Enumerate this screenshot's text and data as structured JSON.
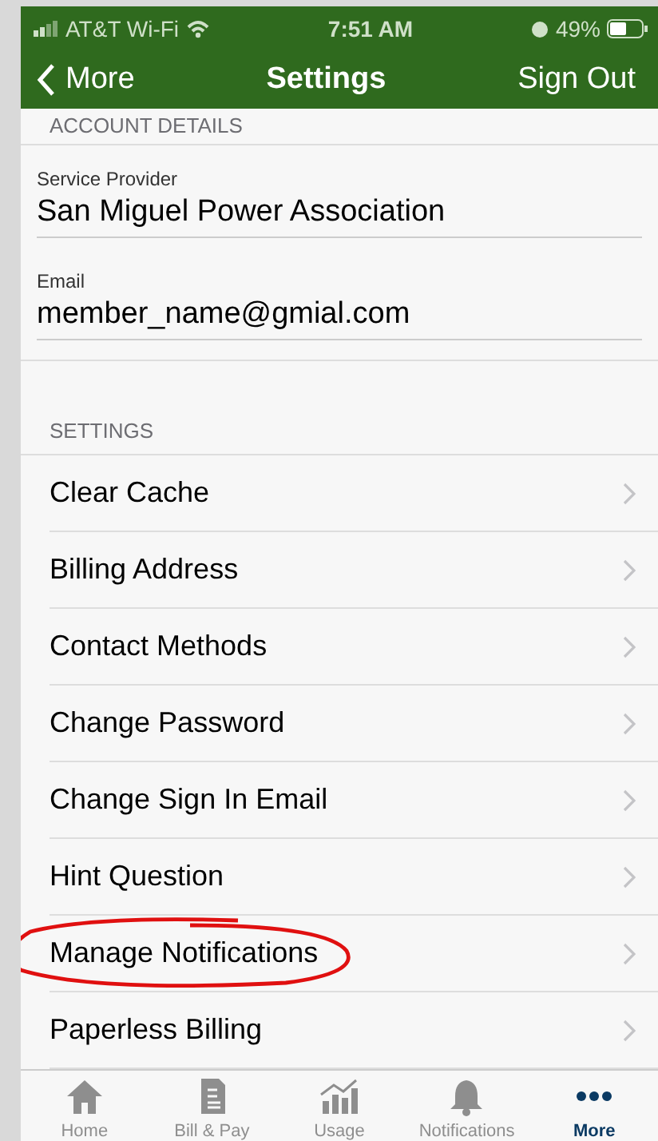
{
  "status_bar": {
    "carrier": "AT&T Wi-Fi",
    "time": "7:51 AM",
    "battery": "49%"
  },
  "nav": {
    "back": "More",
    "title": "Settings",
    "action": "Sign Out"
  },
  "account_details": {
    "header": "ACCOUNT DETAILS",
    "fields": [
      {
        "label": "Service Provider",
        "value": "San Miguel Power Association"
      },
      {
        "label": "Email",
        "value": "member_name@gmial.com"
      }
    ]
  },
  "settings": {
    "header": "SETTINGS",
    "items": [
      {
        "label": "Clear Cache",
        "circled": false
      },
      {
        "label": "Billing Address",
        "circled": false
      },
      {
        "label": "Contact Methods",
        "circled": false
      },
      {
        "label": "Change Password",
        "circled": false
      },
      {
        "label": "Change Sign In Email",
        "circled": false
      },
      {
        "label": "Hint Question",
        "circled": false
      },
      {
        "label": "Manage Notifications",
        "circled": true
      },
      {
        "label": "Paperless Billing",
        "circled": false
      }
    ]
  },
  "tab_bar": [
    {
      "kind": "home",
      "label": "Home",
      "selected": false
    },
    {
      "kind": "bill",
      "label": "Bill & Pay",
      "selected": false
    },
    {
      "kind": "usage",
      "label": "Usage",
      "selected": false
    },
    {
      "kind": "bell",
      "label": "Notifications",
      "selected": false
    },
    {
      "kind": "more",
      "label": "More",
      "selected": true
    }
  ]
}
